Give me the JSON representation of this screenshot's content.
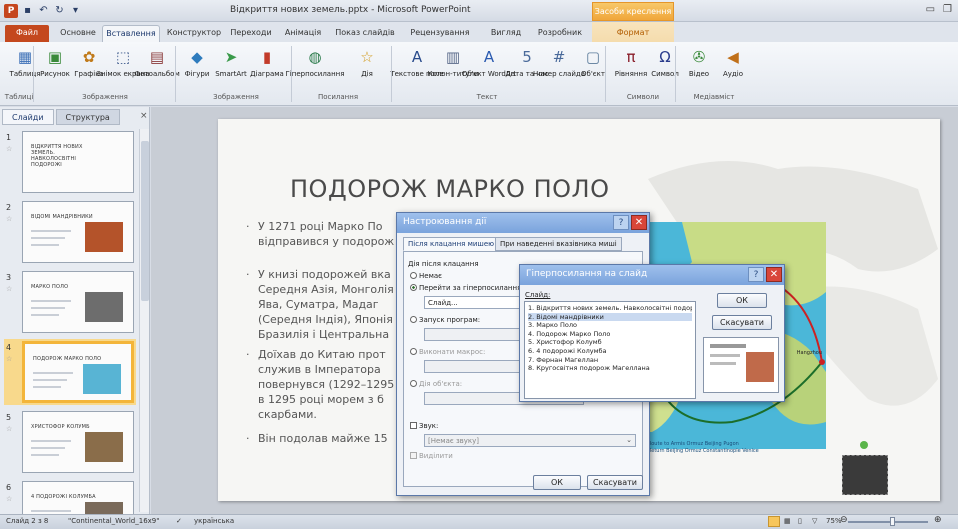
{
  "app": {
    "window_title": "Відкриття нових земель.pptx - Microsoft PowerPoint",
    "contextual_group": "Засоби креслення",
    "logo": "P"
  },
  "tabs": {
    "file": "Файл",
    "items": [
      "Основне",
      "Вставлення",
      "Конструктор",
      "Переходи",
      "Анімація",
      "Показ слайдів",
      "Рецензування",
      "Вигляд",
      "Розробник",
      "Формат"
    ]
  },
  "ribbon": {
    "buttons": [
      {
        "label": "Таблиця",
        "icon": "table-icon",
        "glyph": "▦",
        "color": "#3b6fb6"
      },
      {
        "label": "Рисунок",
        "icon": "picture-icon",
        "glyph": "▣",
        "color": "#3a8a3a"
      },
      {
        "label": "Графіка",
        "icon": "clipart-icon",
        "glyph": "✿",
        "color": "#c07a1a"
      },
      {
        "label": "Знімок екрана",
        "icon": "screenshot-icon",
        "glyph": "⬚",
        "color": "#3d5a8c"
      },
      {
        "label": "Фотоальбом",
        "icon": "photoalbum-icon",
        "glyph": "▤",
        "color": "#8a3a3a"
      },
      {
        "label": "Фігури",
        "icon": "shapes-icon",
        "glyph": "◆",
        "color": "#2e7bbd"
      },
      {
        "label": "SmartArt",
        "icon": "smartart-icon",
        "glyph": "➤",
        "color": "#3a9a4a"
      },
      {
        "label": "Діаграма",
        "icon": "chart-icon",
        "glyph": "▮",
        "color": "#c23b2a"
      },
      {
        "label": "Гіперпосилання",
        "icon": "hyperlink-icon",
        "glyph": "◍",
        "color": "#2a7a4a"
      },
      {
        "label": "Дія",
        "icon": "action-icon",
        "glyph": "☆",
        "color": "#d29a1a"
      },
      {
        "label": "Текстове поле",
        "icon": "textbox-icon",
        "glyph": "A",
        "color": "#2a4c8c"
      },
      {
        "label": "Колон-титули",
        "icon": "header-footer-icon",
        "glyph": "▥",
        "color": "#5a6a8a"
      },
      {
        "label": "Об'єкт WordArt",
        "icon": "wordart-icon",
        "glyph": "A",
        "color": "#2a5ab0"
      },
      {
        "label": "Дата та час",
        "icon": "datetime-icon",
        "glyph": "5",
        "color": "#4a6a9a"
      },
      {
        "label": "Номер слайда",
        "icon": "slide-number-icon",
        "glyph": "#",
        "color": "#4a6a9a"
      },
      {
        "label": "Об'єкт",
        "icon": "object-icon",
        "glyph": "▢",
        "color": "#5a7a9a"
      },
      {
        "label": "Рівняння",
        "icon": "equation-icon",
        "glyph": "π",
        "color": "#8a1e2a"
      },
      {
        "label": "Символ",
        "icon": "symbol-icon",
        "glyph": "Ω",
        "color": "#2a3c8c"
      },
      {
        "label": "Відео",
        "icon": "video-icon",
        "glyph": "✇",
        "color": "#3a8a3a"
      },
      {
        "label": "Аудіо",
        "icon": "audio-icon",
        "glyph": "◀",
        "color": "#c0701a"
      }
    ],
    "groups": [
      "Таблиці",
      "Зображення",
      "Зображення",
      "Посилання",
      "Текст",
      "Символи",
      "Медіавміст"
    ]
  },
  "side_panel": {
    "tabs": [
      "Слайди",
      "Структура"
    ],
    "close": "×",
    "slides": [
      {
        "num": "1",
        "title": "ВІДКРИТТЯ НОВИХ ЗЕМЕЛЬ. НАВКОЛОСВІТНІ ПОДОРОЖІ"
      },
      {
        "num": "2",
        "title": "ВІДОМІ МАНДРІВНИКИ"
      },
      {
        "num": "3",
        "title": "МАРКО ПОЛО"
      },
      {
        "num": "4",
        "title": "ПОДОРОЖ МАРКО ПОЛО"
      },
      {
        "num": "5",
        "title": "ХРИСТОФОР КОЛУМБ"
      },
      {
        "num": "6",
        "title": "4 ПОДОРОЖІ КОЛУМБА"
      }
    ]
  },
  "slide": {
    "title": "ПОДОРОЖ МАРКО ПОЛО",
    "bullets": [
      [
        "У 1271 році Марко По",
        "відправився у подорож"
      ],
      [
        "У книзі подорожей вка",
        "Середня Азія, Монголія",
        "Ява, Суматра, Мадаг",
        "(Середня Індія), Японія",
        "Бразилія і Центральна"
      ],
      [
        "Доїхав до Китаю прот",
        "служив в Імператора",
        "повернувся (1292–1295",
        "в 1295 році морем з б",
        "скарбами."
      ],
      [
        "Він подолав майже 15"
      ]
    ],
    "map_legend": [
      "Route to Armis Ormuz Beijing Pugon",
      "Return Beijing Ormuz Constantinople Venice"
    ],
    "map_label": "Hangzhou"
  },
  "dialog_action": {
    "title": "Настроювання дії",
    "tab_click": "Після клацання мишею",
    "tab_hover": "При наведенні вказівника миші",
    "section": "Дія після клацання",
    "opt_none": "Немає",
    "opt_hyperlink": "Перейти за гіперпосиланням:",
    "hyperlink_value": "Слайд...",
    "opt_run_program": "Запуск програм:",
    "opt_run_macro": "Виконати макрос:",
    "opt_object_action": "Дія об'єкта:",
    "sound_label": "Звук:",
    "sound_value": "[Немає звуку]",
    "highlight_label": "Виділити",
    "ok": "ОК",
    "cancel": "Скасувати"
  },
  "dialog_hyperlink": {
    "title": "Гіперпосилання на слайд",
    "list_label": "Слайд:",
    "items": [
      "1. Відкриття нових земель. Навколосвітні подорожі",
      "2. Відомі мандрівники",
      "3. Марко Поло",
      "4. Подорож Марко Поло",
      "5. Христофор Колумб",
      "6. 4 подорожі Колумба",
      "7. Фернан Магеллан",
      "8. Кругосвітня подорож Магеллана"
    ],
    "selected_index": 1,
    "ok": "ОК",
    "cancel": "Скасувати"
  },
  "status": {
    "slide_info": "Слайд 2 з 8",
    "theme": "\"Continental_World_16x9\"",
    "language": "українська",
    "zoom": "75%"
  }
}
